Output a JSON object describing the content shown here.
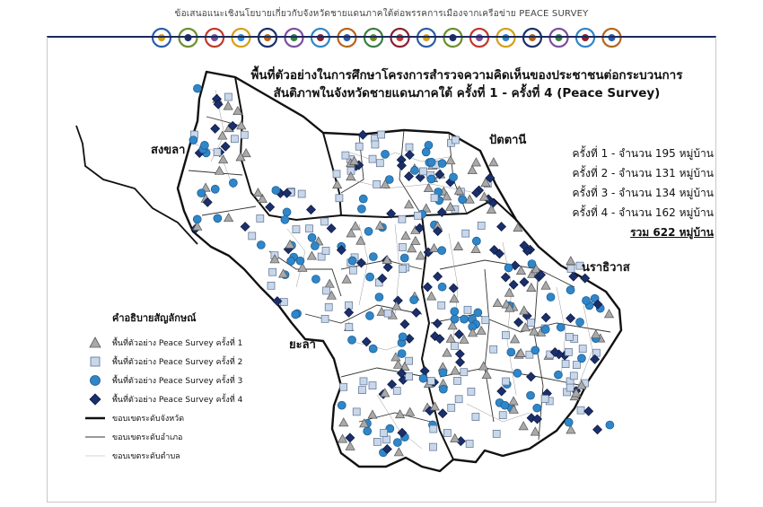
{
  "header": {
    "title": "ข้อเสนอแนะเชิงนโยบายเกี่ยวกับจังหวัดชายแดนภาคใต้ต่อพรรคการเมืองจากเครือข่าย PEACE SURVEY",
    "logos": [
      "partner-logo-1",
      "partner-logo-2",
      "partner-logo-3",
      "partner-logo-4",
      "partner-logo-5",
      "partner-logo-6",
      "partner-logo-7",
      "partner-logo-8",
      "partner-logo-9",
      "partner-logo-10",
      "partner-logo-11",
      "partner-logo-12",
      "partner-logo-13",
      "partner-logo-14",
      "partner-logo-15",
      "partner-logo-16",
      "partner-logo-17",
      "partner-logo-18"
    ]
  },
  "map": {
    "title_line1": "พื้นที่ตัวอย่างในการศึกษาโครงการสำรวจความคิดเห็นของประชาชนต่อกระบวนการ",
    "title_line2": "สันติภาพในจังหวัดชายแดนภาคใต้ ครั้งที่ 1 - ครั้งที่ 4 (Peace Survey)",
    "provinces": {
      "songkhla": "สงขลา",
      "pattani": "ปัตตานี",
      "narathiwat": "นราธิวาส",
      "yala": "ยะลา"
    },
    "stats": [
      "ครั้งที่ 1 - จำนวน 195 หมู่บ้าน",
      "ครั้งที่ 2 - จำนวน 131 หมู่บ้าน",
      "ครั้งที่ 3 - จำนวน 134 หมู่บ้าน",
      "ครั้งที่ 4 - จำนวน 162 หมู่บ้าน"
    ],
    "total": "รวม 622 หมู่บ้าน",
    "colors": {
      "survey1": "#a9a9a9",
      "survey2": "#c9d7ea",
      "survey3": "#2f86c9",
      "survey4": "#1a2f6b",
      "boundary": "#111111"
    }
  },
  "legend": {
    "title": "คำอธิบายสัญลักษณ์",
    "items": [
      {
        "symbol": "triangle",
        "label": "พื้นที่ตัวอย่าง Peace Survey ครั้งที่ 1"
      },
      {
        "symbol": "square",
        "label": "พื้นที่ตัวอย่าง Peace Survey ครั้งที่ 2"
      },
      {
        "symbol": "circle",
        "label": "พื้นที่ตัวอย่าง Peace Survey ครั้งที่ 3"
      },
      {
        "symbol": "diamond",
        "label": "พื้นที่ตัวอย่าง Peace Survey ครั้งที่ 4"
      },
      {
        "symbol": "thick-line",
        "label": "ขอบเขตระดับจังหวัด"
      },
      {
        "symbol": "thin-line",
        "label": "ขอบเขตระดับอำเภอ"
      },
      {
        "symbol": "hair-line",
        "label": "ขอบเขตระดับตำบล"
      }
    ]
  }
}
